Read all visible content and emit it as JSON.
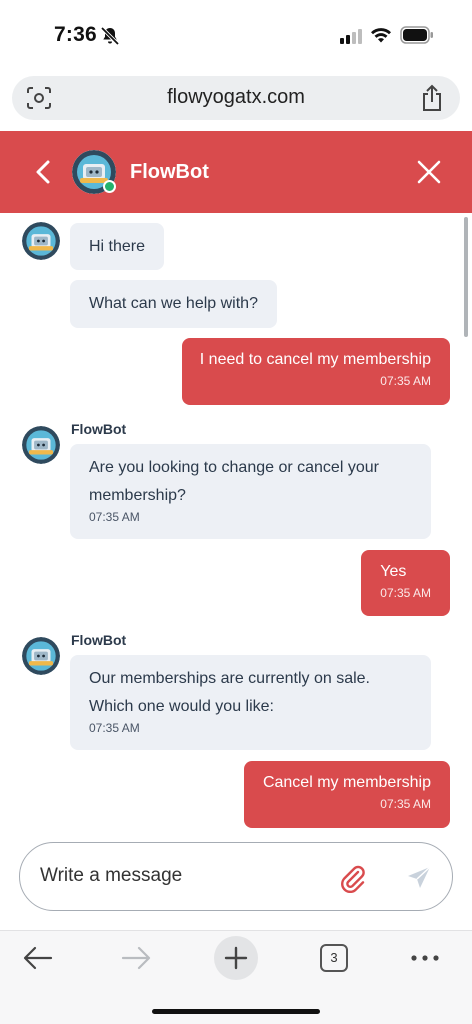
{
  "status_bar": {
    "time": "7:36"
  },
  "browser": {
    "url": "flowyogatx.com",
    "tab_count": "3"
  },
  "chat": {
    "title": "FlowBot",
    "messages": [
      {
        "sender": "bot",
        "text": "Hi there"
      },
      {
        "sender": "bot",
        "text": "What can we help with?"
      },
      {
        "sender": "user",
        "text": "I need to cancel my membership",
        "time": "07:35 AM"
      },
      {
        "sender": "bot",
        "name": "FlowBot",
        "text": "Are you looking to change or cancel your membership?",
        "time": "07:35 AM"
      },
      {
        "sender": "user",
        "text": "Yes",
        "time": "07:35 AM"
      },
      {
        "sender": "bot",
        "name": "FlowBot",
        "text": "Our memberships are currently on sale. Which one would you like:",
        "time": "07:35 AM"
      },
      {
        "sender": "user",
        "text": "Cancel my membership",
        "time": "07:35 AM"
      }
    ],
    "composer": {
      "placeholder": "Write a message"
    }
  },
  "colors": {
    "accent": "#d94b4d",
    "bot_bubble": "#edf0f5",
    "online": "#25b36d"
  },
  "icons": [
    "bell-slash-icon",
    "signal-icon",
    "wifi-icon",
    "battery-icon",
    "camera-search-icon",
    "share-icon",
    "back-icon",
    "close-icon",
    "paperclip-icon",
    "send-icon",
    "nav-back-icon",
    "nav-forward-icon",
    "plus-icon",
    "more-icon"
  ]
}
